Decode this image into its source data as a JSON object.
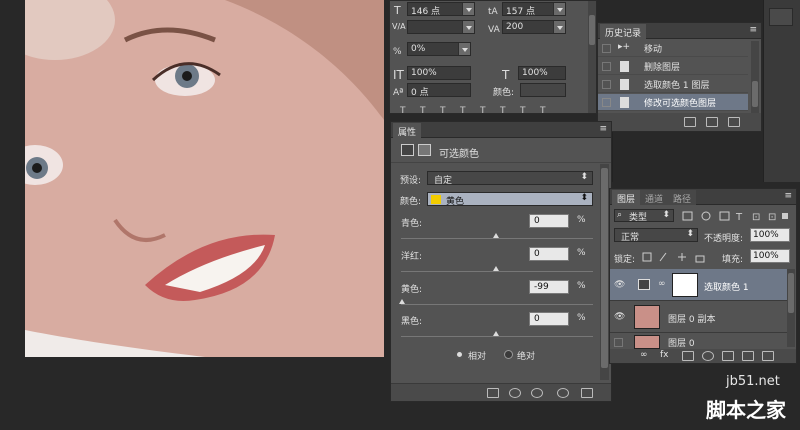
{
  "character": {
    "font_size": "146 点",
    "leading": "157 点",
    "kerning_label": "V/A",
    "tracking": "200",
    "scale_percent": "0%",
    "vertical_scale": "100%",
    "horizontal_scale": "100%",
    "baseline": "0 点",
    "color_label": "颜色:"
  },
  "history": {
    "tab": "历史记录",
    "items": [
      {
        "label": "移动"
      },
      {
        "label": "删除图层"
      },
      {
        "label": "选取颜色 1 图层"
      },
      {
        "label": "修改可选颜色图层"
      }
    ]
  },
  "properties": {
    "tab": "属性",
    "title": "可选颜色",
    "preset_label": "预设:",
    "preset_value": "自定",
    "colors_label": "颜色:",
    "colors_value": "黄色",
    "yellow_swatch": "#f2cc00",
    "sliders": [
      {
        "label": "青色:",
        "value": "0",
        "unit": "%",
        "pos": 0.5
      },
      {
        "label": "洋红:",
        "value": "0",
        "unit": "%",
        "pos": 0.5
      },
      {
        "label": "黄色:",
        "value": "-99",
        "unit": "%",
        "pos": 0.005
      },
      {
        "label": "黑色:",
        "value": "0",
        "unit": "%",
        "pos": 0.5
      }
    ],
    "relative_label": "相对",
    "absolute_label": "绝对"
  },
  "layers": {
    "tabs": [
      "图层",
      "通道",
      "路径"
    ],
    "filter_label": "类型",
    "blend_mode": "正常",
    "opacity_label": "不透明度:",
    "opacity_value": "100%",
    "lock_label": "锁定:",
    "fill_label": "填充:",
    "fill_value": "100%",
    "items": [
      {
        "name": "选取颜色 1"
      },
      {
        "name": "图层 0 副本"
      },
      {
        "name": "图层 0"
      }
    ]
  },
  "watermark": {
    "site": "jb51.net",
    "brand": "脚本之家"
  }
}
